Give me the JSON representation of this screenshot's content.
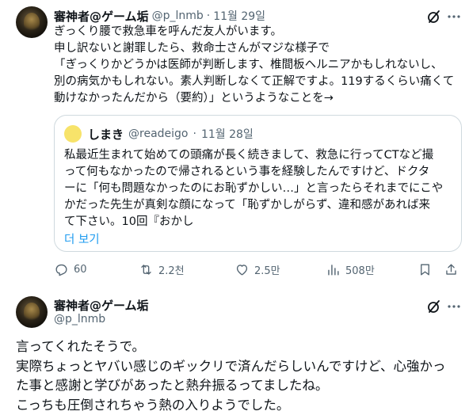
{
  "tweet1": {
    "display_name": "審神者@ゲーム垢",
    "handle": "@p_lnmb",
    "separator": "·",
    "date": "11월 29일",
    "lines": [
      "ぎっくり腰で救急車を呼んだ友人がいます。",
      "申し訳ないと謝罪したら、救命士さんがマジな様子で",
      "「ぎっくりかどうかは医師が判断します、椎間板ヘルニアかもしれないし、",
      "別の病気かもしれない。素人判断しなくて正解ですよ。119するくらい痛くて",
      "動けなかったんだから（要約）」というようなことを→"
    ],
    "quote": {
      "display_name": "しまき",
      "handle": "@readeigo",
      "separator": "·",
      "date": "11월 28일",
      "lines": [
        "私最近生まれて始めての頭痛が長く続きまして、救急に行ってCTなど撮",
        "って何もなかったので帰されるという事を経験したんですけど、ドクタ",
        "ーに「何も問題なかったのにお恥ずかしい…」と言ったらそれまでにこや",
        "かだった先生が真剣な顔になって「恥ずかしがらず、違和感があれば来",
        "て下さい。10回『おかし"
      ],
      "show_more": "더 보기"
    },
    "actions": {
      "replies": "60",
      "reposts": "2.2천",
      "likes": "2.5만",
      "views": "508만"
    }
  },
  "tweet2": {
    "display_name": "審神者@ゲーム垢",
    "handle": "@p_lnmb",
    "lines": [
      "言ってくれたそうで。",
      "実際ちょっとヤバい感じのギックリで済んだらしいんですけど、心強かっ",
      "た事と感謝と学びがあったと熱弁振るってましたね。",
      "こっちも圧倒されちゃう熱の入りようでした。"
    ]
  },
  "icons": {
    "grok": "grok-icon",
    "more": "more-icon",
    "reply": "reply-icon",
    "repost": "repost-icon",
    "like": "heart-icon",
    "views": "views-icon",
    "bookmark": "bookmark-icon",
    "share": "share-icon"
  },
  "colors": {
    "text": "#0f1419",
    "secondary": "#536471",
    "link": "#1d9bf0",
    "border": "#cfd9de"
  }
}
